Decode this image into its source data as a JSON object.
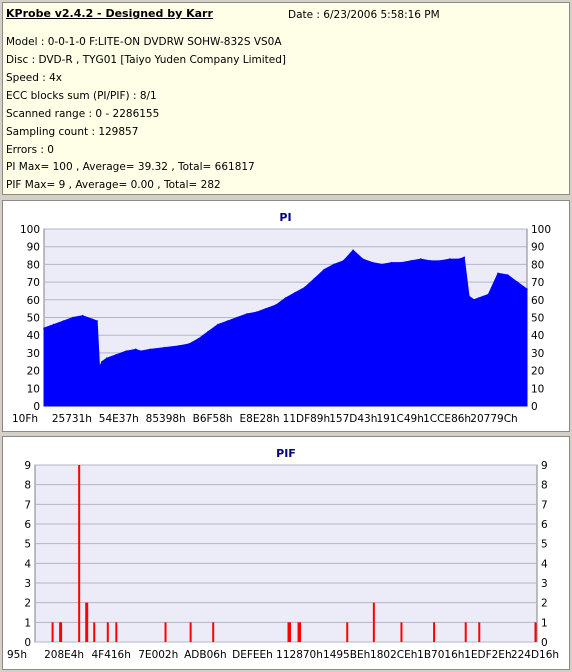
{
  "info": {
    "title": "KProbe v2.4.2 - Designed by Karr",
    "date": "Date : 6/23/2006 5:58:16 PM",
    "lines": [
      "Model : 0-0-1-0 F:LITE-ON DVDRW SOHW-832S  VS0A",
      "Disc : DVD-R , TYG01 [Taiyo Yuden Company Limited]",
      "Speed : 4x",
      "ECC blocks sum (PI/PIF) : 8/1",
      "Scanned range : 0 - 2286155",
      "Sampling count : 129857",
      "Errors : 0",
      "PI Max= 100 , Average= 39.32 , Total= 661817",
      "PIF Max= 9 , Average= 0.00 , Total= 282"
    ]
  },
  "chart_data": [
    {
      "type": "area",
      "title": "PI",
      "ylim": [
        0,
        100
      ],
      "yticks": [
        0,
        10,
        20,
        30,
        40,
        50,
        60,
        70,
        80,
        90,
        100
      ],
      "xtick_labels": [
        "10Fh",
        "25731h",
        "54E37h",
        "85398h",
        "B6F58h",
        "E8E28h",
        "11DF89h",
        "157D43h",
        "191C49h",
        "1CCE86h",
        "20779Ch"
      ],
      "grid": true,
      "color": "#0000ff",
      "x": [
        0,
        0.02,
        0.04,
        0.06,
        0.08,
        0.1,
        0.11,
        0.115,
        0.12,
        0.13,
        0.15,
        0.17,
        0.19,
        0.2,
        0.22,
        0.25,
        0.28,
        0.3,
        0.32,
        0.34,
        0.36,
        0.38,
        0.4,
        0.42,
        0.44,
        0.46,
        0.48,
        0.5,
        0.52,
        0.54,
        0.56,
        0.58,
        0.6,
        0.62,
        0.64,
        0.66,
        0.68,
        0.7,
        0.72,
        0.74,
        0.76,
        0.78,
        0.8,
        0.82,
        0.84,
        0.86,
        0.87,
        0.88,
        0.89,
        0.9,
        0.92,
        0.94,
        0.96,
        0.98,
        1.0
      ],
      "values": [
        44,
        46,
        48,
        50,
        51,
        49,
        48,
        22,
        25,
        27,
        29,
        31,
        32,
        31,
        32,
        33,
        34,
        35,
        38,
        42,
        46,
        48,
        50,
        52,
        53,
        55,
        57,
        61,
        64,
        67,
        72,
        77,
        80,
        82,
        88,
        83,
        81,
        80,
        81,
        81,
        82,
        83,
        82,
        82,
        83,
        83,
        84,
        62,
        60,
        61,
        63,
        75,
        74,
        70,
        66
      ]
    },
    {
      "type": "bar",
      "title": "PIF",
      "ylim": [
        0,
        9
      ],
      "yticks": [
        0,
        1,
        2,
        3,
        4,
        5,
        6,
        7,
        8,
        9
      ],
      "xtick_labels": [
        "95h",
        "208E4h",
        "4F416h",
        "7E002h",
        "ADB06h",
        "DEFEEh",
        "112870h",
        "1495BEh",
        "1802CEh",
        "1B7016h",
        "1EDF2Eh",
        "224D16h"
      ],
      "grid": true,
      "color": "#ff0000",
      "x": [
        0.035,
        0.05,
        0.052,
        0.088,
        0.102,
        0.104,
        0.118,
        0.145,
        0.162,
        0.26,
        0.31,
        0.355,
        0.505,
        0.508,
        0.525,
        0.528,
        0.622,
        0.675,
        0.73,
        0.795,
        0.858,
        0.885,
        0.997
      ],
      "values": [
        1,
        1,
        1,
        9,
        2,
        2,
        1,
        1,
        1,
        1,
        1,
        1,
        1,
        1,
        1,
        1,
        1,
        2,
        1,
        1,
        1,
        1,
        1
      ]
    }
  ]
}
